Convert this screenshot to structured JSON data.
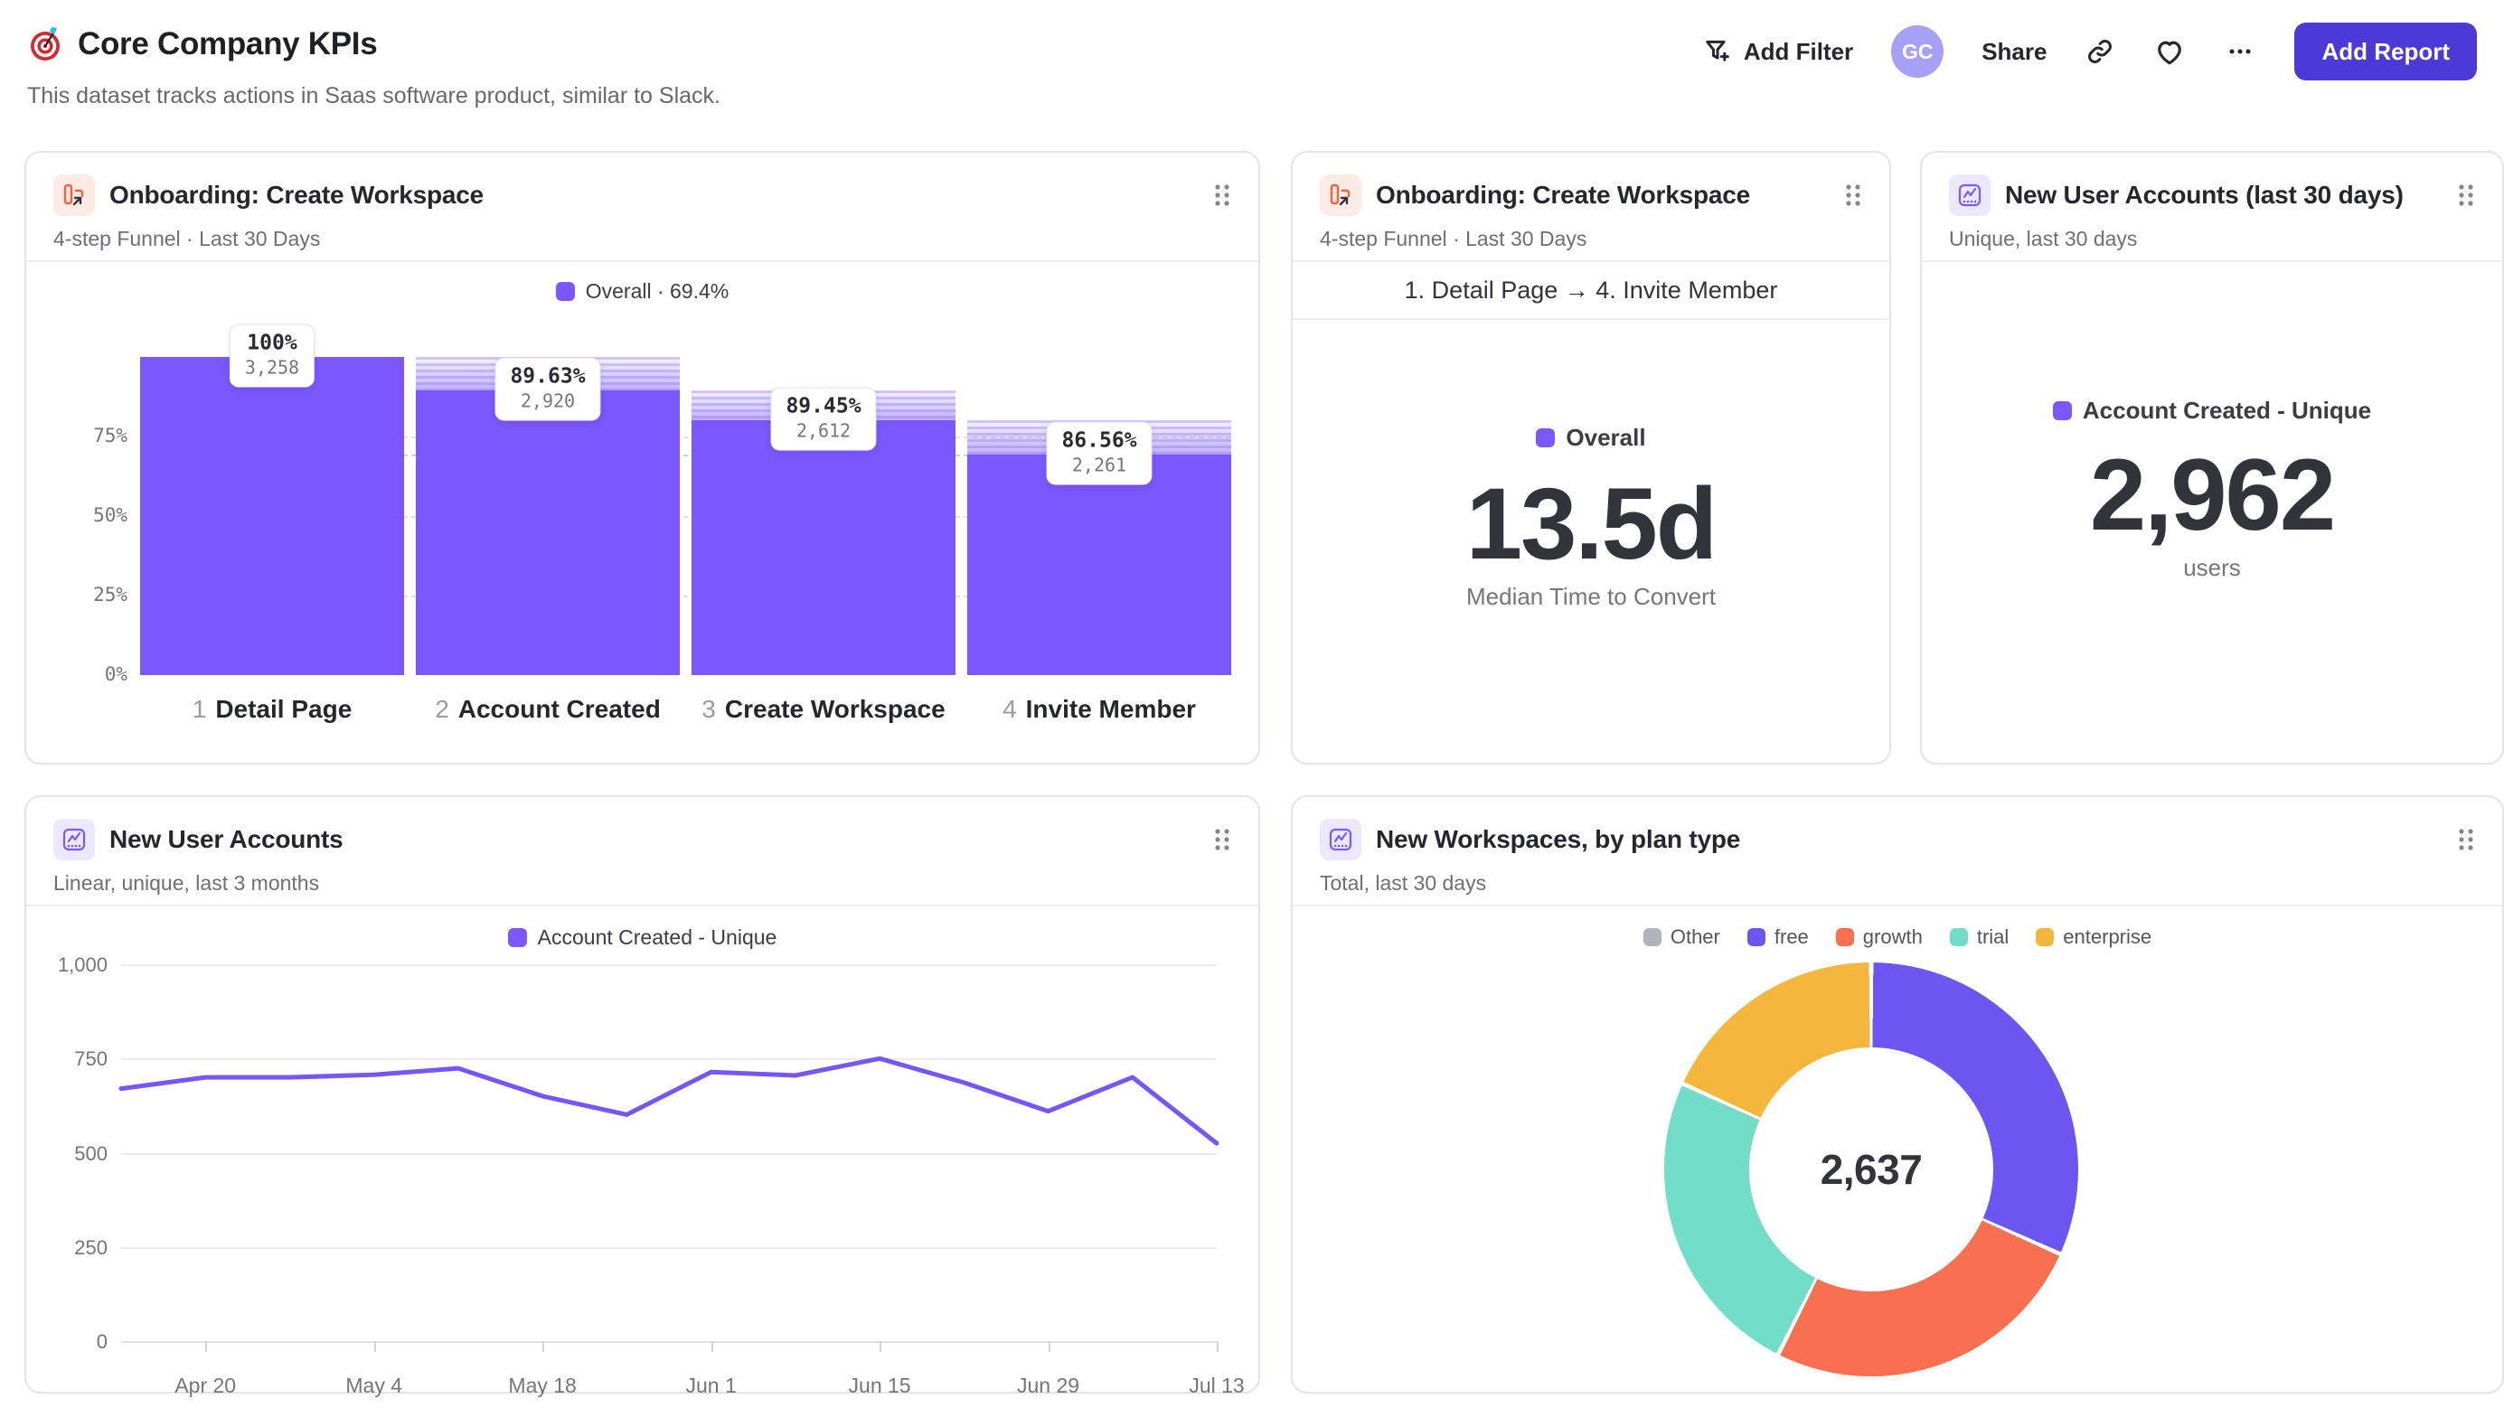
{
  "page": {
    "title": "Core Company KPIs",
    "subtitle": "This dataset tracks actions in Saas software product, similar to Slack."
  },
  "header": {
    "add_filter_label": "Add Filter",
    "avatar_initials": "GC",
    "share_label": "Share",
    "add_report_label": "Add Report"
  },
  "colors": {
    "accent_purple": "#7a57ff",
    "button_purple": "#4b3ad8",
    "donut_other": "#b2b2bc",
    "donut_free": "#6c55f0",
    "donut_growth": "#f8704f",
    "donut_trial": "#72dec9",
    "donut_enterprise": "#f4b63c"
  },
  "cards": {
    "funnel": {
      "title": "Onboarding: Create Workspace",
      "subtitle": "4-step Funnel · Last 30 Days",
      "legend": "Overall · 69.4%"
    },
    "median": {
      "title": "Onboarding: Create Workspace",
      "subtitle": "4-step Funnel · Last 30 Days",
      "range": "1. Detail Page → 4. Invite Member",
      "legend": "Overall",
      "value": "13.5d",
      "caption": "Median Time to Convert"
    },
    "users30": {
      "title": "New User Accounts (last 30 days)",
      "subtitle": "Unique, last 30 days",
      "legend": "Account Created - Unique",
      "value": "2,962",
      "caption": "users"
    },
    "users_trend": {
      "title": "New User Accounts",
      "subtitle": "Linear, unique, last 3 months",
      "legend": "Account Created - Unique"
    },
    "workspaces": {
      "title": "New Workspaces, by plan type",
      "subtitle": "Total, last 30 days"
    }
  },
  "chart_data": [
    {
      "type": "bar",
      "subtype": "funnel",
      "title": "Onboarding: Create Workspace",
      "legend": "Overall · 69.4%",
      "overall_conversion_pct": 69.4,
      "ylim": [
        0,
        100
      ],
      "yticks": [
        {
          "label": "75%",
          "pct": 75
        },
        {
          "label": "50%",
          "pct": 50
        },
        {
          "label": "25%",
          "pct": 25
        },
        {
          "label": "0%",
          "pct": 0
        }
      ],
      "steps": [
        {
          "num": "1",
          "label": "Detail Page",
          "pct_label": "100%",
          "count_label": "3,258",
          "count": 3258,
          "overall_pct": 100
        },
        {
          "num": "2",
          "label": "Account Created",
          "pct_label": "89.63%",
          "count_label": "2,920",
          "count": 2920,
          "overall_pct": 89.63
        },
        {
          "num": "3",
          "label": "Create Workspace",
          "pct_label": "89.45%",
          "count_label": "2,612",
          "count": 2612,
          "overall_pct": 80.17
        },
        {
          "num": "4",
          "label": "Invite Member",
          "pct_label": "86.56%",
          "count_label": "2,261",
          "count": 2261,
          "overall_pct": 69.4
        }
      ]
    },
    {
      "type": "line",
      "title": "New User Accounts",
      "series": [
        {
          "name": "Account Created - Unique",
          "color": "#7656fa",
          "values": [
            670,
            700,
            700,
            707,
            724,
            650,
            601,
            714,
            705,
            750,
            686,
            610,
            700,
            525
          ]
        }
      ],
      "ylim": [
        0,
        1000
      ],
      "yticks": [
        {
          "label": "1,000",
          "value": 1000
        },
        {
          "label": "750",
          "value": 750
        },
        {
          "label": "500",
          "value": 500
        },
        {
          "label": "250",
          "value": 250
        },
        {
          "label": "0",
          "value": 0
        }
      ],
      "tick_labels": [
        "Apr 20",
        "May 4",
        "May 18",
        "Jun 1",
        "Jun 15",
        "Jun 29",
        "Jul 13"
      ],
      "tick_indices": [
        1,
        3,
        5,
        7,
        9,
        11,
        13
      ],
      "grid": true,
      "legend_position": "top"
    },
    {
      "type": "pie",
      "subtype": "donut",
      "title": "New Workspaces, by plan type",
      "center_label": "2,637",
      "total": 2637,
      "series": [
        {
          "name": "Other",
          "value": 0,
          "color": "#b2b2bc"
        },
        {
          "name": "free",
          "value": 836,
          "color": "#6c55f0"
        },
        {
          "name": "growth",
          "value": 678,
          "color": "#f8704f"
        },
        {
          "name": "trial",
          "value": 643,
          "color": "#72dec9"
        },
        {
          "name": "enterprise",
          "value": 480,
          "color": "#f4b63c"
        }
      ],
      "legend_position": "top"
    }
  ]
}
